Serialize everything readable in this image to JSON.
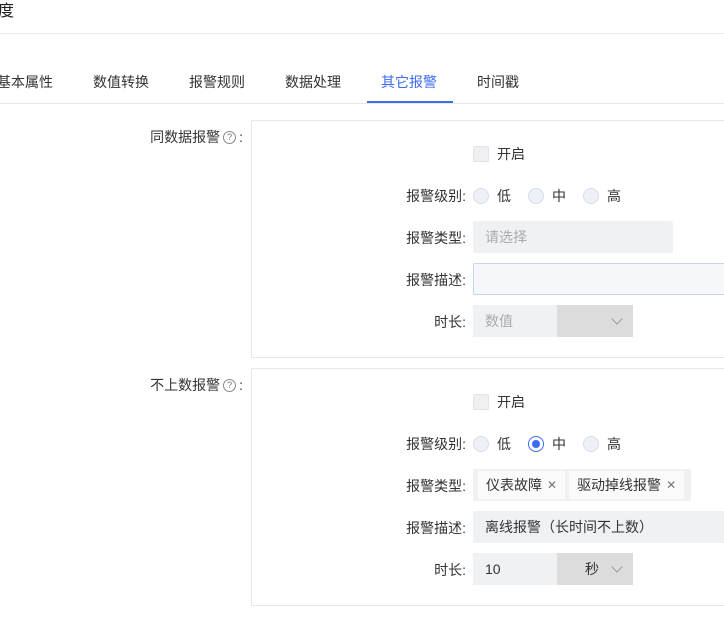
{
  "header": {
    "title": "度"
  },
  "tabs": [
    {
      "label": "基本属性",
      "active": false
    },
    {
      "label": "数值转换",
      "active": false
    },
    {
      "label": "报警规则",
      "active": false
    },
    {
      "label": "数据处理",
      "active": false
    },
    {
      "label": "其它报警",
      "active": true
    },
    {
      "label": "时间戳",
      "active": false
    }
  ],
  "colors": {
    "accent": "#3c6cf0"
  },
  "same_data_alarm": {
    "label": "同数据报警",
    "help_icon": "question-circle-icon",
    "enable_label": "开启",
    "enabled": false,
    "level_label": "报警级别:",
    "levels": [
      "低",
      "中",
      "高"
    ],
    "selected_level": "",
    "type_label": "报警类型:",
    "type_placeholder": "请选择",
    "desc_label": "报警描述:",
    "desc_value": "",
    "duration_label": "时长:",
    "duration_placeholder": "数值",
    "duration_unit": ""
  },
  "no_upload_alarm": {
    "label": "不上数报警",
    "help_icon": "question-circle-icon",
    "enable_label": "开启",
    "enabled": false,
    "level_label": "报警级别:",
    "levels": [
      "低",
      "中",
      "高"
    ],
    "selected_level": "中",
    "type_label": "报警类型:",
    "type_tags": [
      "仪表故障",
      "驱动掉线报警"
    ],
    "desc_label": "报警描述:",
    "desc_value": "离线报警（长时间不上数）",
    "duration_label": "时长:",
    "duration_value": "10",
    "duration_unit": "秒"
  }
}
